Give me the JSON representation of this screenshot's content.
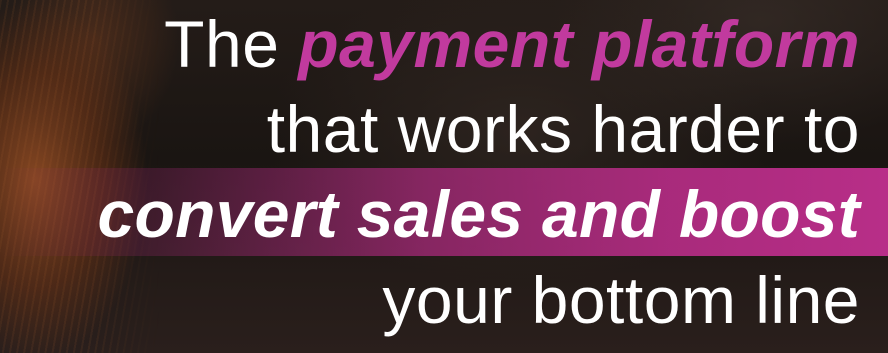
{
  "headline": {
    "line1_plain": "The",
    "line1_accent": "payment platform",
    "line2": "that works harder to",
    "line3": "convert sales and boost",
    "line4": "your bottom line"
  },
  "colors": {
    "accent": "#c13a9e",
    "band": "#b82e88",
    "text": "#ffffff",
    "background": "#1a1512"
  }
}
